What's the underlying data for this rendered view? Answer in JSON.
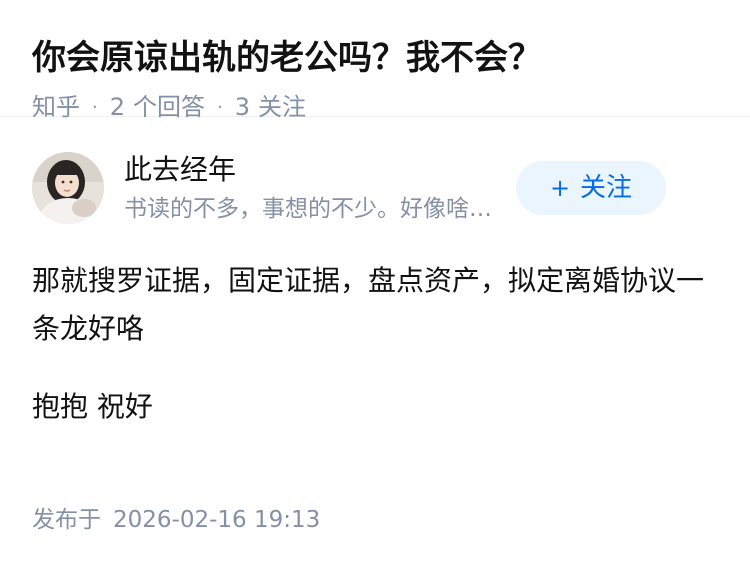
{
  "question": {
    "title": "你会原谅出轨的老公吗？我不会？",
    "source": "知乎",
    "answer_count": "2",
    "answer_label": "个回答",
    "follower_count": "3",
    "follower_label": "关注",
    "separator": "·"
  },
  "answer": {
    "author": {
      "name": "此去经年",
      "bio": "书读的不多，事想的不少。好像啥…",
      "avatar_icon": "avatar-photo"
    },
    "follow_button": {
      "icon": "+",
      "label": "关注",
      "color": "#056de8",
      "background": "#ebf5fd"
    },
    "paragraphs": [
      "那就搜罗证据，固定证据，盘点资产，拟定离婚协议一条龙好咯",
      "抱抱 祝好"
    ],
    "published_label": "发布于",
    "published_time": "2026-02-16 19:13"
  }
}
